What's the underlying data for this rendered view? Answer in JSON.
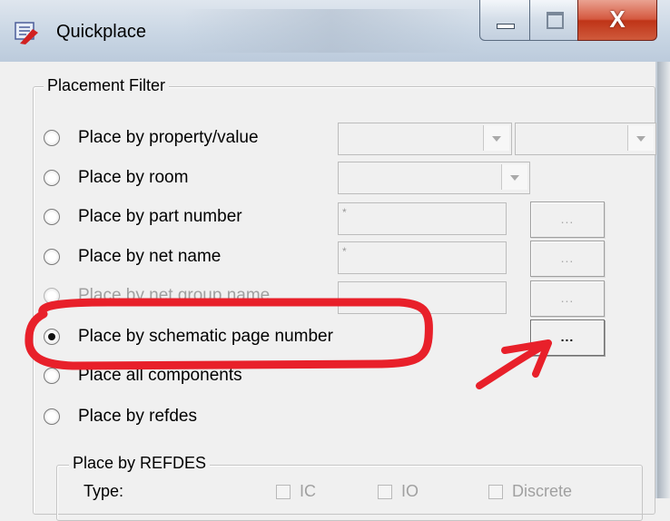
{
  "window": {
    "title": "Quickplace",
    "icon": "quickplace-app-icon",
    "controls": {
      "minimize": "minimize-icon",
      "maximize": "maximize-icon",
      "close_glyph": "X"
    }
  },
  "placement_filter": {
    "label": "Placement Filter",
    "options": [
      {
        "label": "Place by property/value",
        "selected": false,
        "enabled": true
      },
      {
        "label": "Place by room",
        "selected": false,
        "enabled": true
      },
      {
        "label": "Place by part number",
        "selected": false,
        "enabled": true
      },
      {
        "label": "Place by net name",
        "selected": false,
        "enabled": true
      },
      {
        "label": "Place by net group name",
        "selected": false,
        "enabled": false
      },
      {
        "label": "Place by schematic page number",
        "selected": true,
        "enabled": true
      },
      {
        "label": "Place all components",
        "selected": false,
        "enabled": true
      },
      {
        "label": "Place by refdes",
        "selected": false,
        "enabled": true
      }
    ],
    "part_number_value": "*",
    "net_name_value": "*",
    "browse_label": "..."
  },
  "place_by_refdes": {
    "label": "Place by REFDES",
    "type_label": "Type:",
    "checkboxes": [
      {
        "label": "IC",
        "checked": false
      },
      {
        "label": "IO",
        "checked": false
      },
      {
        "label": "Discrete",
        "checked": false
      }
    ]
  },
  "annotation": {
    "color": "#e8202a",
    "shapes": [
      "highlight-ellipse",
      "pointer-arrow"
    ]
  }
}
